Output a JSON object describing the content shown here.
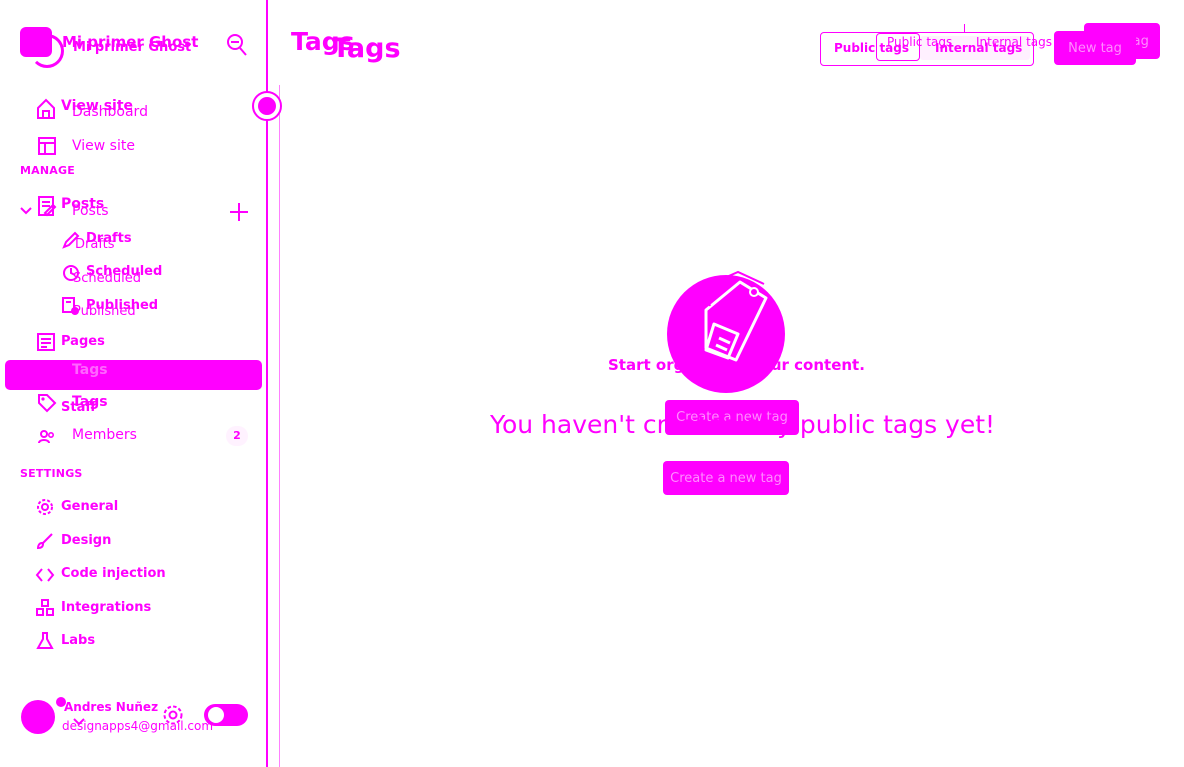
{
  "brand": {
    "name_a": "Mi primer Ghost",
    "name_b": "Mi primer Ghost"
  },
  "sidebar": {
    "layer_a": {
      "view_site": "View site",
      "manage_label": "MANAGE",
      "posts": "Posts",
      "drafts": "Drafts",
      "scheduled": "Scheduled",
      "published": "Published",
      "pages": "Pages",
      "tags": "Tags",
      "staff": "Staff",
      "settings_label": "SETTINGS",
      "general": "General",
      "design": "Design",
      "code_injection": "Code injection",
      "integrations": "Integrations",
      "labs": "Labs"
    },
    "layer_b": {
      "dashboard": "Dashboard",
      "view_site": "View site",
      "posts": "Posts",
      "drafts": "Drafts",
      "scheduled": "Scheduled",
      "published": "Published",
      "tags": "Tags",
      "members": "Members",
      "members_count": "2"
    }
  },
  "user": {
    "name": "Andres Nuñez",
    "email": "designapps4@gmail.com"
  },
  "header": {
    "title_a": "Tags",
    "title_b": "Tags",
    "filter_public_a": "Public tags",
    "filter_internal_a": "Internal tags",
    "filter_public_b": "Public tags",
    "filter_internal_b": "Internal tags",
    "new_tag_a": "New tag",
    "new_tag_b": "New tag"
  },
  "empty_state": {
    "heading_a": "Start organizing your content.",
    "heading_b": "You haven't created any public tags yet!",
    "button_a": "Create a new tag",
    "button_b": "Create a new tag"
  },
  "colors": {
    "accent": "#ff00ff",
    "background": "#ffffff"
  },
  "icons": {
    "sidebar_a": [
      "home-icon",
      "posts-icon",
      "drafts-icon",
      "scheduled-icon",
      "published-icon",
      "pages-icon",
      "tags-icon",
      "staff-icon",
      "gear-icon",
      "brush-icon",
      "code-icon",
      "integrations-icon",
      "labs-icon"
    ],
    "sidebar_b": [
      "home-icon",
      "layout-icon",
      "chevron-down-icon",
      "posts-icon",
      "plus-icon",
      "members-icon"
    ],
    "header": [
      "search-icon",
      "sidebar-toggle-icon"
    ],
    "empty": [
      "tags-illustration-icon"
    ]
  }
}
